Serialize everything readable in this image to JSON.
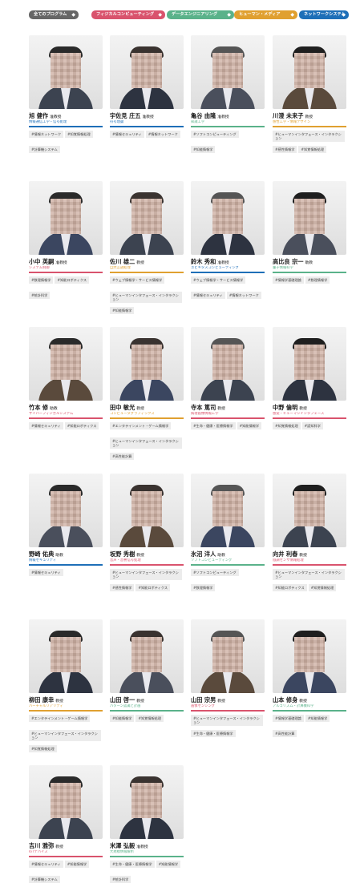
{
  "colors": {
    "all": "#666666",
    "physical": "#d9536d",
    "data": "#5ab28a",
    "human": "#e0a030",
    "network": "#1e6fb8"
  },
  "filters": [
    {
      "label": "全てのプログラム",
      "color": "#666666",
      "icon": "chevron-down-icon"
    },
    {
      "label": "フィジカルコンピューティング",
      "color": "#d9536d",
      "icon": "chevron-down-icon"
    },
    {
      "label": "データエンジニアリング",
      "color": "#5ab28a",
      "icon": "chevron-down-icon"
    },
    {
      "label": "ヒューマン・メディア",
      "color": "#e0a030",
      "icon": "chevron-down-icon"
    },
    {
      "label": "ネットワークシステム",
      "color": "#1e6fb8",
      "icon": "chevron-down-icon"
    }
  ],
  "faculty": [
    {
      "name": "旭 健作",
      "title": "准教授",
      "lab": "情報通信工学・信号処理",
      "color": "#1e6fb8",
      "tags": [
        "#情報ネットワーク",
        "#知覚情報処理",
        "#計算機システム"
      ]
    },
    {
      "name": "宇佐見 庄五",
      "title": "准教授",
      "lab": "符号理論",
      "color": "#1e6fb8",
      "tags": [
        "#情報セキュリティ",
        "#情報ネットワーク"
      ]
    },
    {
      "name": "亀谷 由隆",
      "title": "准教授",
      "lab": "知識工学",
      "color": "#5ab28a",
      "tags": [
        "#ソフトコンピューティング",
        "#知能情報学"
      ]
    },
    {
      "name": "川澄 未来子",
      "title": "教授",
      "lab": "感性工学・情報デザイン",
      "color": "#e0a030",
      "tags": [
        "#ヒューマンインタフェース・インタラクション",
        "#感性情報学",
        "#知覚情報処理"
      ]
    },
    {
      "name": "小中 英嗣",
      "title": "准教授",
      "lab": "システム制御",
      "color": "#d9536d",
      "tags": [
        "#数理情報学",
        "#知能ロボティクス",
        "#統計科学"
      ]
    },
    {
      "name": "佐川 雄二",
      "title": "教授",
      "lab": "自然言語処理",
      "color": "#e0a030",
      "tags": [
        "#ウェブ情報学・サービス情報学",
        "#ヒューマンインタフェース・インタラクション",
        "#知能情報学"
      ]
    },
    {
      "name": "鈴木 秀和",
      "title": "准教授",
      "lab": "ユビキタスコンピューティング",
      "color": "#1e6fb8",
      "tags": [
        "#ウェブ情報学・サービス情報学",
        "#情報セキュリティ",
        "#情報ネットワーク"
      ]
    },
    {
      "name": "高比良 宗一",
      "title": "助教",
      "lab": "量子情報科学",
      "color": "#5ab28a",
      "tags": [
        "#情報学基礎理論",
        "#数理情報学"
      ]
    },
    {
      "name": "竹本 修",
      "title": "助教",
      "lab": "サイバーフィジカルシステム",
      "color": "#d9536d",
      "tags": [
        "#情報セキュリティ",
        "#知能ロボティクス"
      ]
    },
    {
      "name": "田中 敏光",
      "title": "教授",
      "lab": "コンピュータグラフィックス",
      "color": "#e0a030",
      "tags": [
        "#エンタテインメント・ゲーム情報学",
        "#ヒューマンインタフェース・インタラクション",
        "#高性能計算"
      ]
    },
    {
      "name": "寺本 篤司",
      "title": "教授",
      "lab": "病理画像情報工学",
      "color": "#d9536d",
      "tags": [
        "#生命・健康・医療情報学",
        "#知能情報学"
      ]
    },
    {
      "name": "中野 倫明",
      "title": "教授",
      "lab": "感覚・ヒューマンインタフェース",
      "color": "#d9536d",
      "tags": [
        "#知覚情報処理",
        "#認知科学"
      ]
    },
    {
      "name": "野崎 佑典",
      "title": "助教",
      "lab": "情報セキュリティ",
      "color": "#1e6fb8",
      "tags": [
        "#情報セキュリティ"
      ]
    },
    {
      "name": "坂野 秀樹",
      "title": "教授",
      "lab": "音声・音響信号処理",
      "color": "#d9536d",
      "tags": [
        "#ヒューマンインタフェース・インタラクション",
        "#感性情報学",
        "#知能ロボティクス"
      ]
    },
    {
      "name": "氷沼 洋人",
      "title": "助教",
      "lab": "ソフトコンピューティング",
      "color": "#5ab28a",
      "tags": [
        "#ソフトコンピューティング",
        "#数理情報学"
      ]
    },
    {
      "name": "向井 利春",
      "title": "教授",
      "lab": "協調センサ情報処理",
      "color": "#d9536d",
      "tags": [
        "#ヒューマンインタフェース・インタラクション",
        "#知能ロボティクス",
        "#知覚情報処理"
      ]
    },
    {
      "name": "柳田 康幸",
      "title": "教授",
      "lab": "バーチャルリアリティ",
      "color": "#e0a030",
      "tags": [
        "#エンタテインメント・ゲーム情報学",
        "#ヒューマンインタフェース・インタラクション",
        "#知覚情報処理"
      ]
    },
    {
      "name": "山田 啓一",
      "title": "教授",
      "lab": "パターン認識と計画",
      "color": "#5ab28a",
      "tags": [
        "#知能情報学",
        "#知覚情報処理"
      ]
    },
    {
      "name": "山田 宗男",
      "title": "教授",
      "lab": "画像センシング",
      "color": "#d9536d",
      "tags": [
        "#ヒューマンインタフェース・インタラクション",
        "#生命・健康・医療情報学"
      ]
    },
    {
      "name": "山本 修身",
      "title": "教授",
      "lab": "アルゴリズム・計算機科学",
      "color": "#5ab28a",
      "tags": [
        "#情報学基礎理論",
        "#知能情報学",
        "#高性能計算"
      ]
    },
    {
      "name": "吉川 雅弥",
      "title": "教授",
      "lab": "IoTデバイス",
      "color": "#d9536d",
      "tags": [
        "#情報セキュリティ",
        "#知能情報学",
        "#計算機システム"
      ]
    },
    {
      "name": "米澤 弘毅",
      "title": "准教授",
      "lab": "大規模情報解析",
      "color": "#5ab28a",
      "tags": [
        "#生命・健康・医療情報学",
        "#知能情報学",
        "#統計科学"
      ]
    }
  ]
}
